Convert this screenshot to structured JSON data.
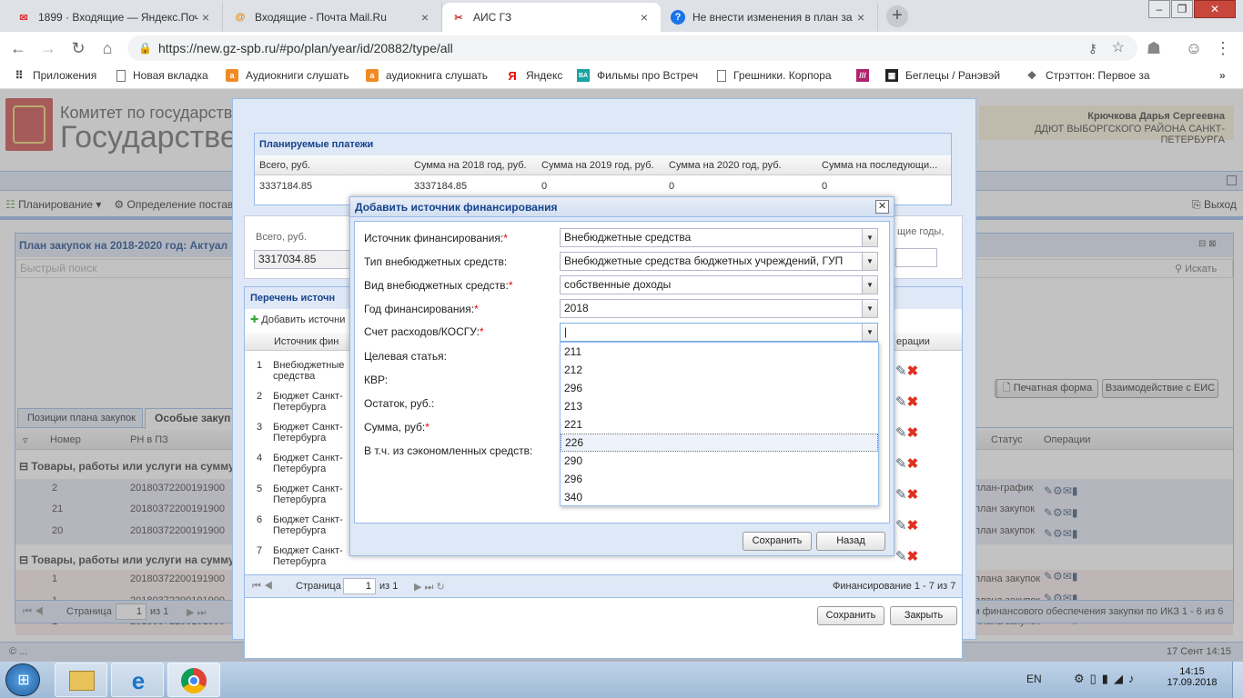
{
  "browser": {
    "tabs": [
      {
        "title": "1899 · Входящие — Яндекс.Почта",
        "icon": "mail-icon",
        "active": false
      },
      {
        "title": "Входящие - Почта Mail.Ru",
        "icon": "mailru-icon",
        "active": false
      },
      {
        "title": "АИС ГЗ",
        "icon": "tools-icon",
        "active": true
      },
      {
        "title": "Не внести изменения в план за",
        "icon": "help-icon",
        "active": false
      }
    ],
    "url": "https://new.gz-spb.ru/#po/plan/year/id/20882/type/all",
    "bookmarks": [
      {
        "label": "Приложения",
        "icon": "apps-icon"
      },
      {
        "label": "Новая вкладка",
        "icon": "page-icon"
      },
      {
        "label": "Аудиокниги слушать",
        "icon": "audio-icon"
      },
      {
        "label": "аудиокнига слушать",
        "icon": "audio-icon"
      },
      {
        "label": "Яндекс",
        "icon": "yandex-icon"
      },
      {
        "label": "Фильмы про Встреч",
        "icon": "film-icon"
      },
      {
        "label": "Грешники. Корпора",
        "icon": "page-icon"
      },
      {
        "label": "",
        "icon": "stripes-icon"
      },
      {
        "label": "Беглецы / Ранэвэй",
        "icon": "film-strip-icon"
      },
      {
        "label": "Стрэттон: Первое за",
        "icon": "wolf-icon"
      }
    ]
  },
  "app": {
    "header_line1": "Комитет по государственном",
    "header_line2": "Государстве",
    "user_name": "Крючкова Дарья Сергеевна",
    "user_org": "ДДЮТ ВЫБОРГСКОГО РАЙОНА САНКТ-ПЕТЕРБУРГА",
    "menu_planning": "Планирование",
    "menu_definition": "Определение постав",
    "menu_exit": "Выход",
    "plan_title": "План закупок на 2018-2020 год: Актуал",
    "quick_search_placeholder": "Быстрый поиск",
    "search_btn": "Искать",
    "tab_positions": "Позиции плана закупок",
    "tab_special": "Особые закуп",
    "col_number": "Номер",
    "col_rn": "РН в ПЗ",
    "col_status": "Статус",
    "col_operations": "Операции",
    "group1": "Товары, работы или услуги на сумму,",
    "group2": "Товары, работы или услуги на сумму,",
    "rows": [
      {
        "num": "2",
        "rn": "20180372200191900",
        "status": "план-график"
      },
      {
        "num": "21",
        "rn": "20180372200191900",
        "status": "план закупок"
      },
      {
        "num": "20",
        "rn": "20180372200191900",
        "status": "план закупок"
      },
      {
        "num": "1",
        "rn": "20180372200191900",
        "status": "плана закупок"
      },
      {
        "num": "1",
        "rn": "20180372200191900",
        "status": "плана закупок"
      },
      {
        "num": "1",
        "rn": "20180372200191900",
        "status": "плана закупок"
      }
    ],
    "btn_print": "Печатная форма",
    "btn_eis": "Взаимодействие с ЕИС",
    "pager_page": "Страница",
    "pager_page_num": "1",
    "pager_of": "из 1",
    "footer_info": "м финансового обеспечения закупки по ИКЗ 1 - 6 из 6",
    "footer_copyright": "© ...",
    "footer_date": "17 Сент 14:15"
  },
  "modal": {
    "planned_title": "Планируемые платежи",
    "planned_headers": [
      "Всего, руб.",
      "Сумма на 2018 год, руб.",
      "Сумма на 2019 год, руб.",
      "Сумма на 2020 год, руб.",
      "Сумма на последующи..."
    ],
    "planned_values": [
      "3337184.85",
      "3337184.85",
      "0",
      "0",
      "0"
    ],
    "total_label": "Всего, руб.",
    "total_value": "3317034.85",
    "next_years_label": "щие годы,",
    "sources_title": "Перечень источн",
    "add_source": "Добавить источни",
    "col_source": "Источник фин",
    "sources": [
      {
        "n": "1",
        "name": "Внебюджетные средства"
      },
      {
        "n": "2",
        "name": "Бюджет Санкт-Петербурга"
      },
      {
        "n": "3",
        "name": "Бюджет Санкт-Петербурга"
      },
      {
        "n": "4",
        "name": "Бюджет Санкт-Петербурга"
      },
      {
        "n": "5",
        "name": "Бюджет Санкт-Петербурга"
      },
      {
        "n": "6",
        "name": "Бюджет Санкт-Петербурга"
      },
      {
        "n": "7",
        "name": "Бюджет Санкт-Петербурга"
      }
    ],
    "col_ops": "ерации",
    "pager_page": "Страница",
    "pager_page_num": "1",
    "pager_of": "из 1",
    "pager_info": "Финансирование 1 - 7 из 7",
    "btn_save": "Сохранить",
    "btn_close": "Закрыть"
  },
  "dialog": {
    "title": "Добавить источник финансирования",
    "fields": {
      "source_label": "Источник финансирования:",
      "source_value": "Внебюджетные средства",
      "type_label": "Тип внебюджетных средств:",
      "type_value": "Внебюджетные средства бюджетных учреждений, ГУП",
      "kind_label": "Вид внебюджетных средств:",
      "kind_value": "собственные доходы",
      "year_label": "Год финансирования:",
      "year_value": "2018",
      "account_label": "Счет расходов/КОСГУ:",
      "account_value": "|",
      "target_label": "Целевая статья:",
      "kvr_label": "КВР:",
      "balance_label": "Остаток, руб.:",
      "sum_label": "Сумма, руб:",
      "saved_label": "В т.ч. из сэкономленных средств:"
    },
    "dropdown_options": [
      "211",
      "212",
      "296",
      "213",
      "221",
      "226",
      "290",
      "296",
      "340"
    ],
    "highlighted_option": "226",
    "save_btn": "Сохранить",
    "back_btn": "Назад",
    "required_mark": "*"
  },
  "taskbar": {
    "lang": "EN",
    "time": "14:15",
    "date": "17.09.2018"
  },
  "colors": {
    "accent": "#99bbe8",
    "required": "#e00000",
    "delete": "#e03020"
  }
}
